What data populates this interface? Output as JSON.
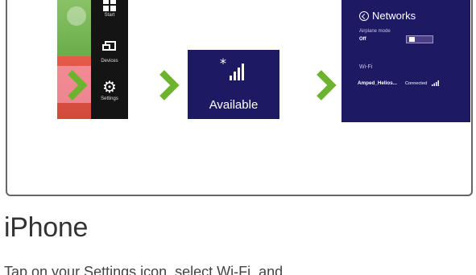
{
  "charms": {
    "start_label": "Start",
    "devices_label": "Devices",
    "settings_label": "Settings"
  },
  "available_tile": {
    "label": "Available"
  },
  "networks_flyout": {
    "title": "Networks",
    "airplane_mode_label": "Airplane mode",
    "airplane_mode_value": "Off",
    "wifi_section": "Wi-Fi",
    "network": {
      "ssid": "Amped_Helios...",
      "status": "Connected"
    }
  },
  "section": {
    "heading": "iPhone",
    "body": "Tap on your Settings icon, select Wi-Fi, and"
  },
  "colors": {
    "accent_green": "#6cb32e",
    "win_purple": "#1e1963"
  }
}
